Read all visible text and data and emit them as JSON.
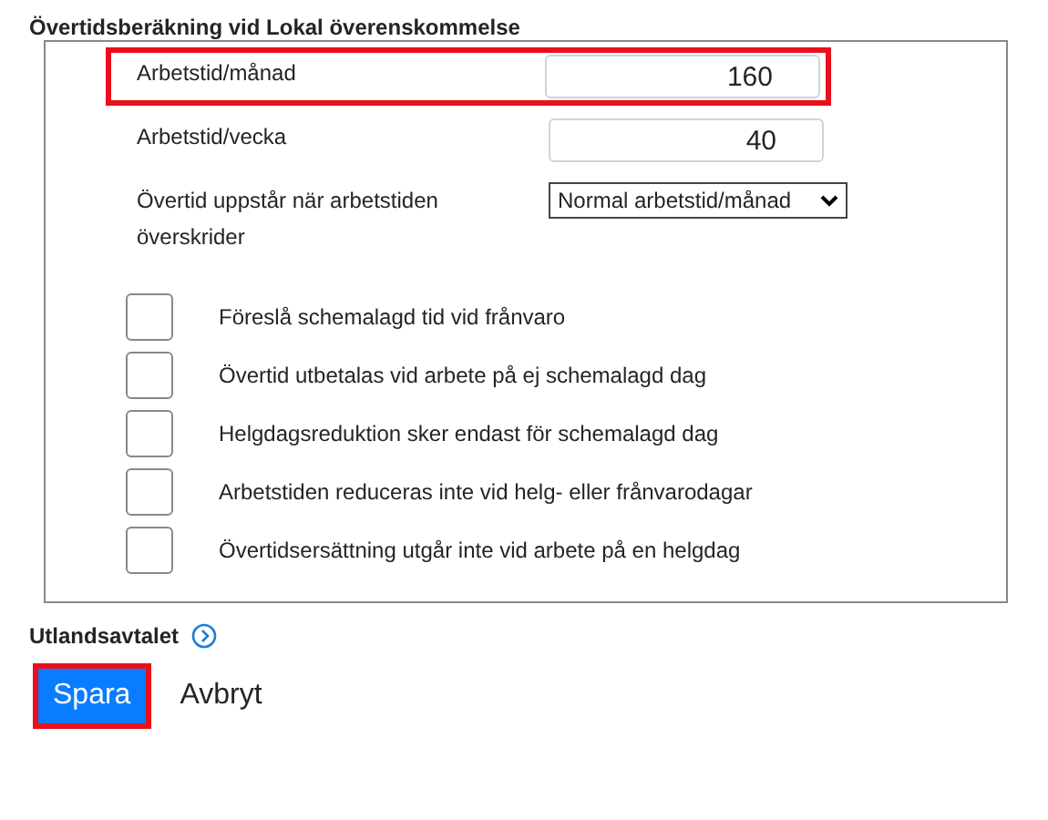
{
  "section_title": "Övertidsberäkning vid Lokal överenskommelse",
  "fields": [
    {
      "kind": "input",
      "label": "Arbetstid/månad",
      "value": "160",
      "highlighted": true
    },
    {
      "kind": "input",
      "label": "Arbetstid/vecka",
      "value": "40",
      "highlighted": false
    },
    {
      "kind": "select",
      "label": "Övertid uppstår när arbetstiden överskrider",
      "value": "Normal arbetstid/månad",
      "highlighted": false
    }
  ],
  "checkboxes": [
    {
      "label": "Föreslå schemalagd tid vid frånvaro",
      "checked": false
    },
    {
      "label": "Övertid utbetalas vid arbete på ej schemalagd dag",
      "checked": false
    },
    {
      "label": "Helgdagsreduktion sker endast för schemalagd dag",
      "checked": false
    },
    {
      "label": "Arbetstiden reduceras inte vid helg- eller frånvarodagar",
      "checked": false
    },
    {
      "label": "Övertidsersättning utgår inte vid arbete på en helgdag",
      "checked": false
    }
  ],
  "subsection": {
    "title": "Utlandsavtalet"
  },
  "buttons": [
    {
      "kind": "primary",
      "label": "Spara",
      "highlighted": true
    },
    {
      "kind": "link",
      "label": "Avbryt",
      "highlighted": false
    }
  ]
}
